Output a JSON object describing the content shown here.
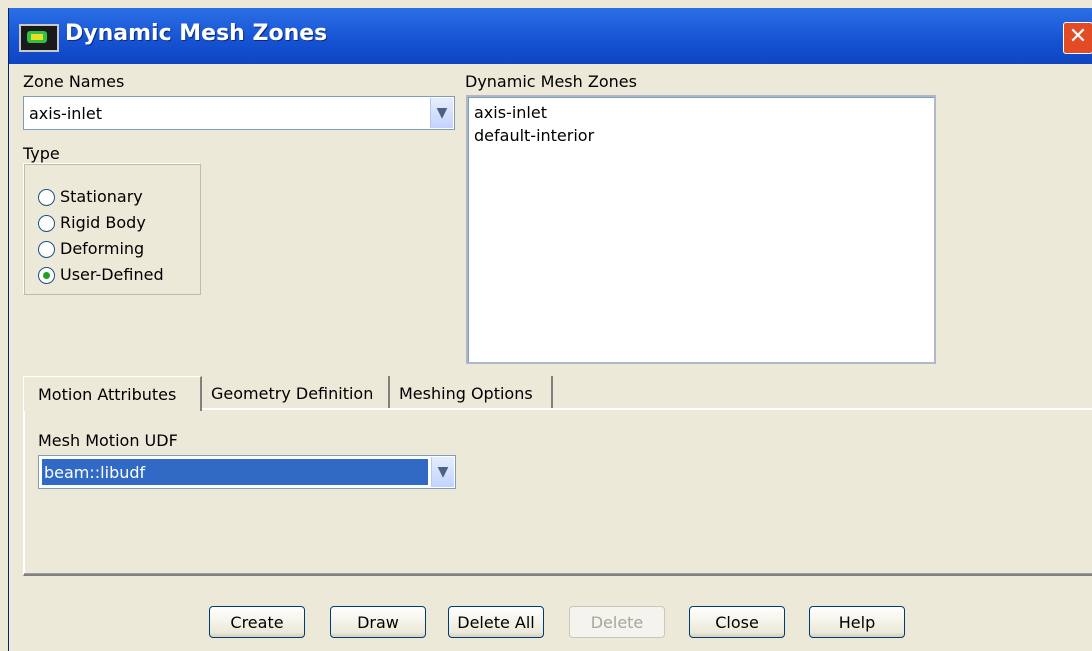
{
  "window": {
    "title": "Dynamic Mesh Zones",
    "close_glyph": "✕"
  },
  "zone_names": {
    "label": "Zone Names",
    "selected": "axis-inlet"
  },
  "type": {
    "label": "Type",
    "options": [
      {
        "label": "Stationary",
        "checked": false
      },
      {
        "label": "Rigid Body",
        "checked": false
      },
      {
        "label": "Deforming",
        "checked": false
      },
      {
        "label": "User-Defined",
        "checked": true
      }
    ]
  },
  "dynamic_mesh_zones": {
    "label": "Dynamic Mesh Zones",
    "items": [
      "axis-inlet",
      "default-interior"
    ]
  },
  "tabs": [
    {
      "label": "Motion Attributes",
      "active": true
    },
    {
      "label": "Geometry Definition",
      "active": false
    },
    {
      "label": "Meshing Options",
      "active": false
    }
  ],
  "motion": {
    "udf_label": "Mesh Motion UDF",
    "udf_selected": "beam::libudf"
  },
  "buttons": {
    "create": "Create",
    "draw": "Draw",
    "delete_all": "Delete All",
    "delete": "Delete",
    "close": "Close",
    "help": "Help"
  },
  "colors": {
    "titlebar": "#1552d3",
    "selection": "#316ac5",
    "radio_dot": "#21a121"
  }
}
